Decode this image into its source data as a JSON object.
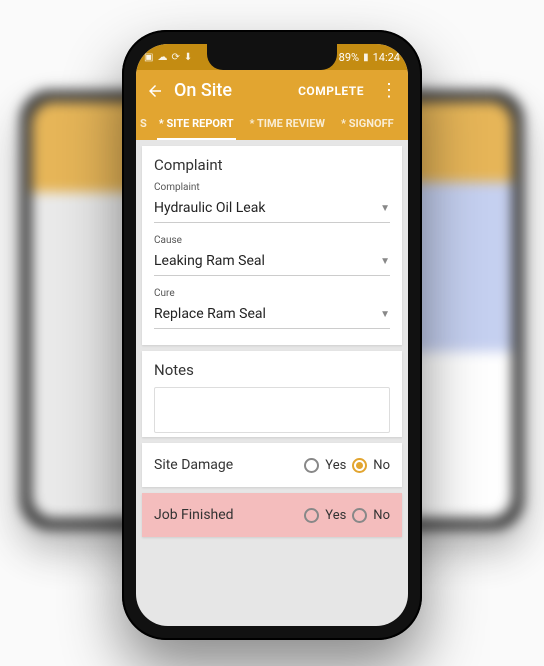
{
  "statusbar": {
    "battery": "89%",
    "time": "14:24"
  },
  "header": {
    "title": "On Site",
    "action": "COMPLETE"
  },
  "tabs": {
    "t0": "S",
    "t1": "* SITE REPORT",
    "t2": "* TIME REVIEW",
    "t3": "* SIGNOFF"
  },
  "complaint": {
    "section": "Complaint",
    "complaint_label": "Complaint",
    "complaint_value": "Hydraulic Oil Leak",
    "cause_label": "Cause",
    "cause_value": "Leaking Ram Seal",
    "cure_label": "Cure",
    "cure_value": "Replace Ram Seal"
  },
  "notes": {
    "title": "Notes"
  },
  "site_damage": {
    "label": "Site Damage",
    "yes": "Yes",
    "no": "No",
    "value": "No"
  },
  "job_finished": {
    "label": "Job Finished",
    "yes": "Yes",
    "no": "No",
    "value": null
  }
}
